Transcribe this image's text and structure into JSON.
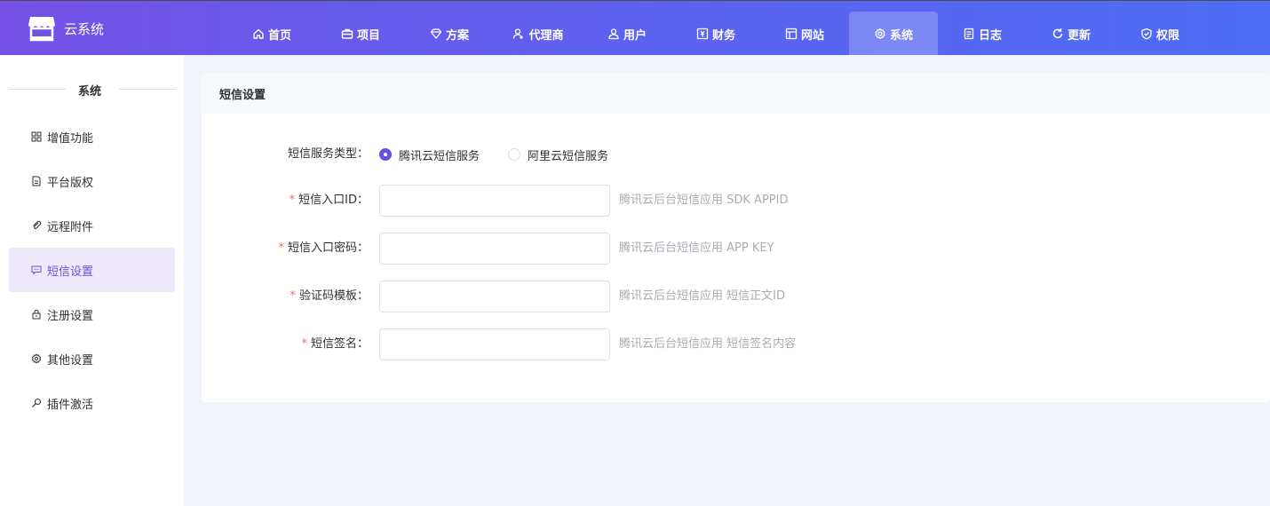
{
  "app": {
    "title": "云系统"
  },
  "nav": [
    {
      "label": "首页",
      "icon": "home-icon"
    },
    {
      "label": "项目",
      "icon": "briefcase-icon"
    },
    {
      "label": "方案",
      "icon": "diamond-icon"
    },
    {
      "label": "代理商",
      "icon": "user-plus-icon"
    },
    {
      "label": "用户",
      "icon": "users-icon"
    },
    {
      "label": "财务",
      "icon": "yen-icon"
    },
    {
      "label": "网站",
      "icon": "layout-icon"
    },
    {
      "label": "系统",
      "icon": "gear-icon",
      "active": true
    },
    {
      "label": "日志",
      "icon": "document-icon"
    },
    {
      "label": "更新",
      "icon": "refresh-icon"
    },
    {
      "label": "权限",
      "icon": "shield-check-icon"
    }
  ],
  "sidebar": {
    "title": "系统",
    "items": [
      {
        "label": "增值功能",
        "icon": "grid-icon"
      },
      {
        "label": "平台版权",
        "icon": "file-icon"
      },
      {
        "label": "远程附件",
        "icon": "paperclip-icon"
      },
      {
        "label": "短信设置",
        "icon": "message-icon",
        "active": true
      },
      {
        "label": "注册设置",
        "icon": "lock-icon"
      },
      {
        "label": "其他设置",
        "icon": "gear-icon"
      },
      {
        "label": "插件激活",
        "icon": "key-icon"
      }
    ]
  },
  "form": {
    "title": "短信设置",
    "service_type": {
      "label": "短信服务类型：",
      "options": [
        {
          "label": "腾讯云短信服务",
          "checked": true
        },
        {
          "label": "阿里云短信服务",
          "checked": false
        }
      ]
    },
    "fields": [
      {
        "label": "短信入口ID：",
        "required": true,
        "value": "",
        "hint": "腾讯云后台短信应用 SDK APPID"
      },
      {
        "label": "短信入口密码：",
        "required": true,
        "value": "",
        "hint": "腾讯云后台短信应用 APP KEY"
      },
      {
        "label": "验证码模板：",
        "required": true,
        "value": "",
        "hint": "腾讯云后台短信应用 短信正文ID"
      },
      {
        "label": "短信签名：",
        "required": true,
        "value": "",
        "hint": "腾讯云后台短信应用 短信签名内容"
      }
    ],
    "required_mark": "*"
  },
  "colors": {
    "accent": "#6a4fe0",
    "header_start": "#7451e6",
    "header_end": "#4e6cf5",
    "required": "#f56c6c",
    "hint": "#a8abb2"
  }
}
